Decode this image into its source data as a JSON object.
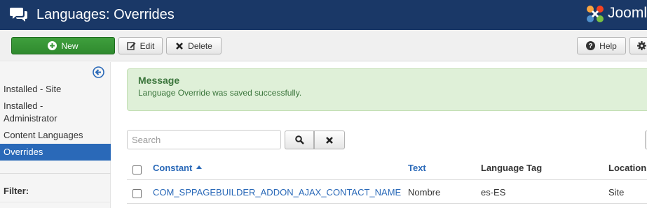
{
  "header": {
    "title": "Languages: Overrides",
    "brand": "Joomla!",
    "title_icon": "comments-icon"
  },
  "toolbar": {
    "new_label": "New",
    "edit_label": "Edit",
    "delete_label": "Delete",
    "help_label": "Help",
    "options_label": "Options"
  },
  "sidebar": {
    "items": [
      {
        "label": "Installed - Site",
        "active": false
      },
      {
        "label": "Installed - Administrator",
        "active": false
      },
      {
        "label": "Content Languages",
        "active": false
      },
      {
        "label": "Overrides",
        "active": true
      }
    ],
    "filter_label": "Filter:"
  },
  "message": {
    "heading": "Message",
    "text": "Language Override was saved successfully."
  },
  "search": {
    "placeholder": "Search",
    "value": ""
  },
  "table": {
    "columns": [
      "Constant",
      "Text",
      "Language Tag",
      "Location"
    ],
    "sorted_column": "Constant",
    "sort_direction": "ascending",
    "rows": [
      {
        "constant": "COM_SPPAGEBUILDER_ADDON_AJAX_CONTACT_NAME",
        "text": "Nombre",
        "language_tag": "es-ES",
        "location": "Site"
      }
    ]
  },
  "colors": {
    "header_bg": "#1a3867",
    "new_button": "#3a973a",
    "active_sidebar": "#2a69b8",
    "link": "#2a69b8",
    "success_bg": "#dff0d8",
    "success_text": "#3c763d"
  }
}
